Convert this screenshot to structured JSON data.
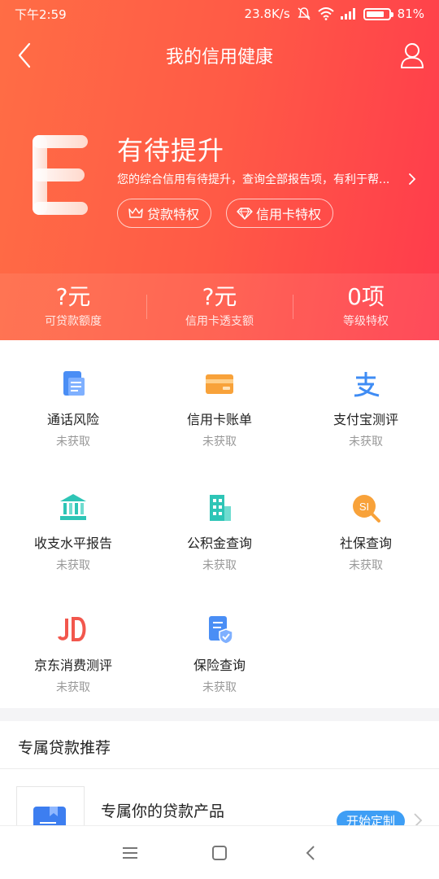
{
  "status_bar": {
    "time": "下午2:59",
    "speed": "23.8K/s",
    "battery": "81%",
    "battery_level": 0.81,
    "icons": [
      "mute-icon",
      "wifi-icon",
      "signal-icon",
      "battery-icon"
    ]
  },
  "nav": {
    "title": "我的信用健康",
    "back_icon": "chevron-left-icon",
    "user_icon": "user-icon"
  },
  "grade": {
    "letter": "E",
    "title": "有待提升",
    "description": "您的综合信用有待提升，查询全部报告项，有利于帮...",
    "tags": [
      {
        "label": "贷款特权",
        "icon": "crown-icon"
      },
      {
        "label": "信用卡特权",
        "icon": "diamond-icon"
      }
    ]
  },
  "stats": [
    {
      "value": "?元",
      "label": "可贷款额度"
    },
    {
      "value": "?元",
      "label": "信用卡透支额"
    },
    {
      "value": "0项",
      "label": "等级特权"
    }
  ],
  "services": [
    {
      "name": "通话风险",
      "status": "未获取",
      "icon": "phone-report-icon",
      "color": "#4a8ef5"
    },
    {
      "name": "信用卡账单",
      "status": "未获取",
      "icon": "credit-card-icon",
      "color": "#f8a23a"
    },
    {
      "name": "支付宝测评",
      "status": "未获取",
      "icon": "alipay-icon",
      "color": "#3f8cf4"
    },
    {
      "name": "收支水平报告",
      "status": "未获取",
      "icon": "bank-icon",
      "color": "#2ec5b6"
    },
    {
      "name": "公积金查询",
      "status": "未获取",
      "icon": "building-icon",
      "color": "#2ec5b6"
    },
    {
      "name": "社保查询",
      "status": "未获取",
      "icon": "social-security-icon",
      "color": "#f8a23a"
    },
    {
      "name": "京东消费测评",
      "status": "未获取",
      "icon": "jd-icon",
      "color": "#f2574d"
    },
    {
      "name": "保险查询",
      "status": "未获取",
      "icon": "insurance-icon",
      "color": "#4a8ef5"
    }
  ],
  "recommend": {
    "title": "专属贷款推荐",
    "product_title": "专属你的贷款产品",
    "button": "开始定制"
  },
  "bottom_nav": [
    "menu-icon",
    "home-icon",
    "back-icon"
  ],
  "colors": {
    "header_start": "#ff6d45",
    "header_end": "#ff3b4c",
    "accent_blue": "#3e9ef5"
  }
}
